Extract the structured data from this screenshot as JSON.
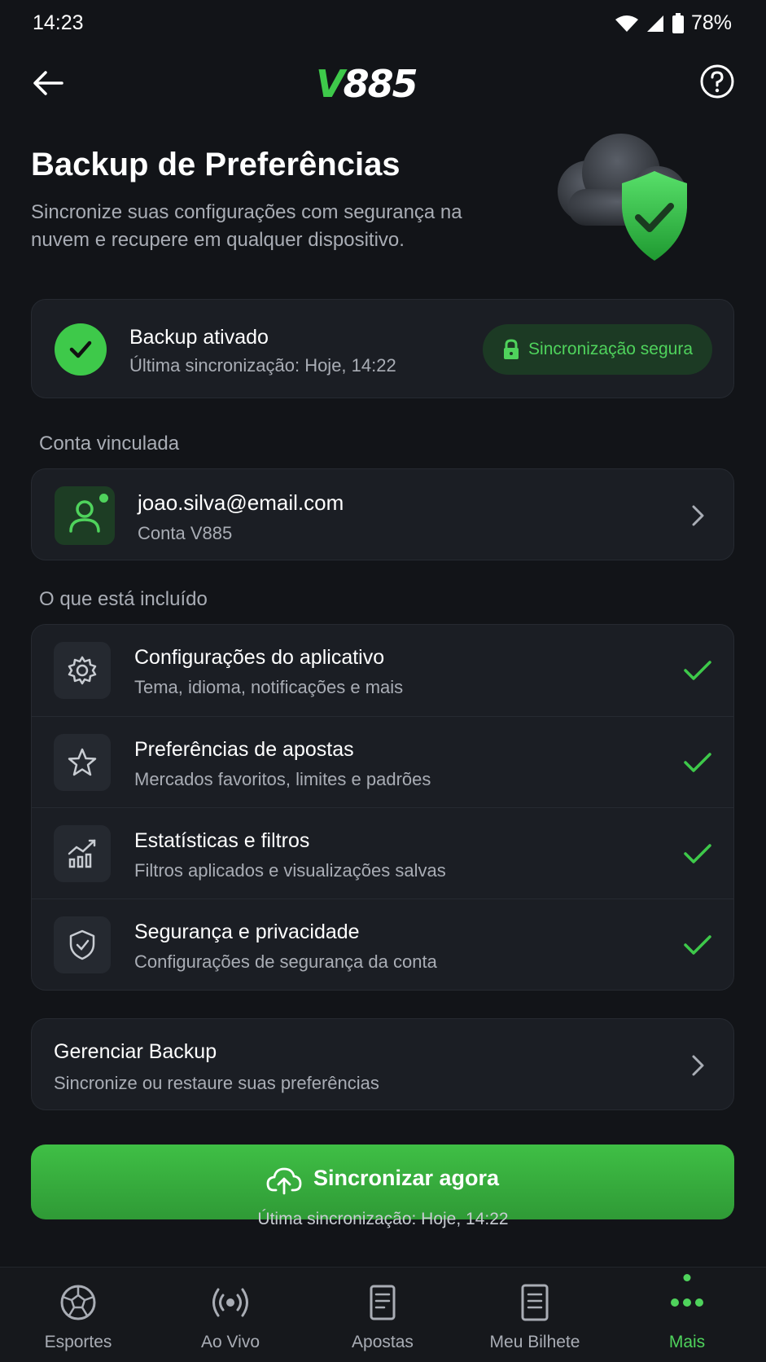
{
  "status_bar": {
    "time": "14:23",
    "battery": "78%"
  },
  "header": {
    "logo_v": "V",
    "logo_num": "885"
  },
  "hero": {
    "title": "Backup de Preferências",
    "subtitle": "Sincronize suas configurações com segurança na nuvem e recupere em qualquer dispositivo."
  },
  "backup_status": {
    "title": "Backup ativado",
    "last_sync": "Última sincronização: Hoje, 14:22",
    "badge": "Sincronização segura"
  },
  "account": {
    "section_label": "Conta vinculada",
    "email": "joao.silva@email.com",
    "type": "Conta V885"
  },
  "included": {
    "section_label": "O que está incluído",
    "items": [
      {
        "title": "Configurações do aplicativo",
        "subtitle": "Tema, idioma, notificações e mais",
        "icon": "gear-icon"
      },
      {
        "title": "Preferências de apostas",
        "subtitle": "Mercados favoritos, limites e padrões",
        "icon": "star-icon"
      },
      {
        "title": "Estatísticas e filtros",
        "subtitle": "Filtros aplicados e visualizações salvas",
        "icon": "chart-icon"
      },
      {
        "title": "Segurança e privacidade",
        "subtitle": "Configurações de segurança da conta",
        "icon": "shield-icon"
      }
    ]
  },
  "manage": {
    "title": "Gerenciar Backup",
    "subtitle": "Sincronize ou restaure suas preferências"
  },
  "sync": {
    "button_label": "Sincronizar agora",
    "note": "Útima sincronização: Hoje, 14:22"
  },
  "nav": {
    "items": [
      {
        "label": "Esportes",
        "icon": "ball-icon"
      },
      {
        "label": "Ao Vivo",
        "icon": "live-icon"
      },
      {
        "label": "Apostas",
        "icon": "bets-icon"
      },
      {
        "label": "Meu Bilhete",
        "icon": "ticket-icon"
      },
      {
        "label": "Mais",
        "icon": "more-icon",
        "active": true
      }
    ]
  },
  "colors": {
    "accent": "#3ec94a",
    "background": "#121418",
    "card": "#1b1e24"
  }
}
